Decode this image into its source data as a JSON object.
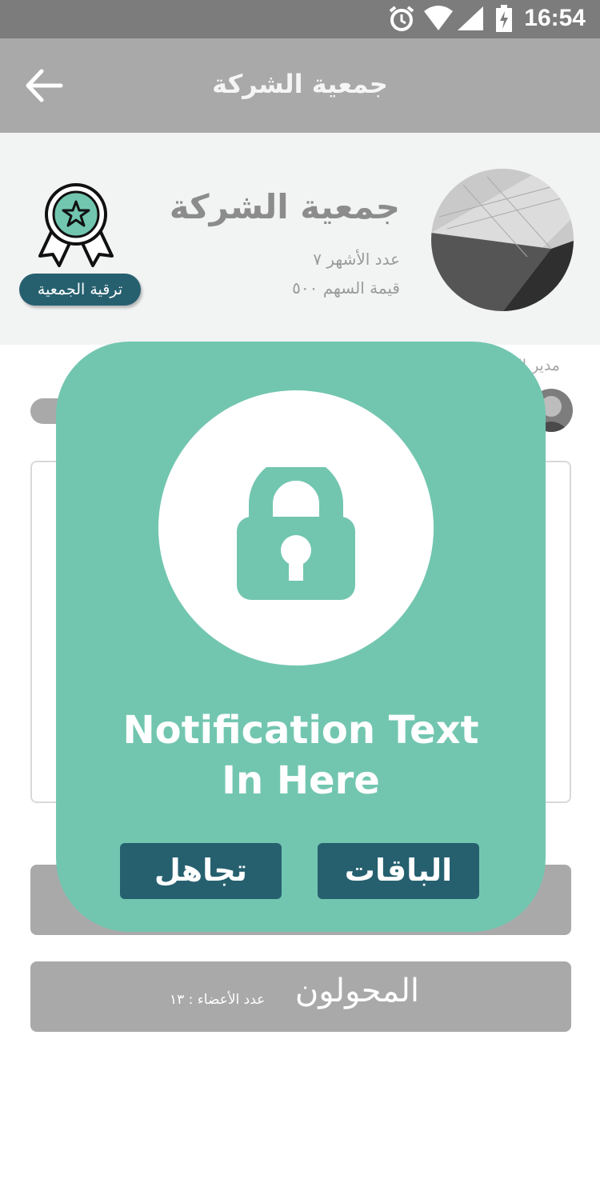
{
  "status_bar": {
    "time": "16:54",
    "icons": [
      "alarm-icon",
      "wifi-icon",
      "signal-icon",
      "battery-charging-icon"
    ]
  },
  "app_bar": {
    "title": "جمعية الشركة",
    "back_icon": "arrow-left-icon"
  },
  "header": {
    "org_name": "جمعية الشركة",
    "months_label": "عدد الأشهر ٧",
    "share_value_label": "قيمة السهم ٥٠٠",
    "upgrade_button": "ترقية الجمعية",
    "badge_icon": "award-ribbon-star-icon"
  },
  "background": {
    "manager_label": "مدير الجمعية",
    "bar2_title": "المحولون",
    "bar2_members": "عدد الأعضاء : ١٣"
  },
  "modal": {
    "icon": "lock-icon",
    "text_line1": "Notification Text",
    "text_line2": "In Here",
    "ignore_button": "تجاهل",
    "packages_button": "الباقات"
  },
  "colors": {
    "accent": "#72c6b0",
    "button": "#26606f",
    "app_bar": "#a9a9a9",
    "status_bar": "#7c7c7c"
  }
}
